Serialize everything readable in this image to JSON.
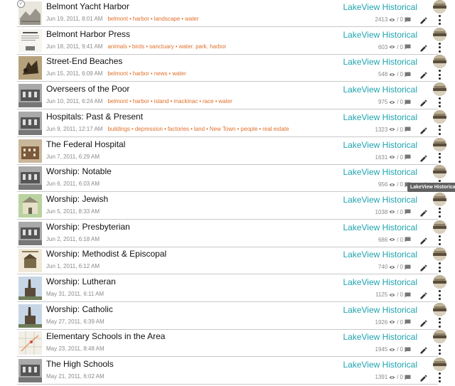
{
  "author_label": "LakeView Historical",
  "tooltip": "LakeView Historical",
  "items": [
    {
      "title": "Belmont Yacht Harbor",
      "date": "Jun 19, 2011, 8:01 AM",
      "tags": [
        "belmont",
        "harbor",
        "landscape",
        "water"
      ],
      "views": "2413",
      "comments": "0",
      "thumb": "sketch"
    },
    {
      "title": "Belmont Harbor Press",
      "date": "Jun 18, 2011, 9:41 AM",
      "tags": [
        "animals",
        "birds",
        "sanctuary",
        "water. park. harbor"
      ],
      "views": "603",
      "comments": "0",
      "thumb": "doc"
    },
    {
      "title": "Street-End Beaches",
      "date": "Jun 15, 2011, 6:09 AM",
      "tags": [
        "belmont",
        "harbor",
        "news",
        "water"
      ],
      "views": "548",
      "comments": "0",
      "thumb": "sepia"
    },
    {
      "title": "Overseers of the Poor",
      "date": "Jun 10, 2011, 6:24 AM",
      "tags": [
        "belmont",
        "harbor",
        "island",
        "mackinac",
        "race",
        "water"
      ],
      "views": "975",
      "comments": "0",
      "thumb": "bw"
    },
    {
      "title": "Hospitals: Past & Present",
      "date": "Jun 9, 2011, 12:17 AM",
      "tags": [
        "buildings",
        "depression",
        "factories",
        "land",
        "New Town",
        "people",
        "real estate"
      ],
      "views": "1323",
      "comments": "0",
      "thumb": "bw"
    },
    {
      "title": "The Federal Hospital",
      "date": "Jun 7, 2011, 6:29 AM",
      "tags": [],
      "views": "1631",
      "comments": "0",
      "thumb": "brown"
    },
    {
      "title": "Worship: Notable",
      "date": "Jun 6, 2011, 6:03 AM",
      "tags": [],
      "views": "956",
      "comments": "0",
      "thumb": "bw"
    },
    {
      "title": "Worship: Jewish",
      "date": "Jun 5, 2011, 8:33 AM",
      "tags": [],
      "views": "1038",
      "comments": "0",
      "thumb": "green"
    },
    {
      "title": "Worship: Presbyterian",
      "date": "Jun 2, 2011, 6:18 AM",
      "tags": [],
      "views": "686",
      "comments": "0",
      "thumb": "bw"
    },
    {
      "title": "Worship: Methodist & Episcopal",
      "date": "Jun 1, 2011, 6:12 AM",
      "tags": [],
      "views": "740",
      "comments": "0",
      "thumb": "card"
    },
    {
      "title": "Worship: Lutheran",
      "date": "May 31, 2011, 6:11 AM",
      "tags": [],
      "views": "1125",
      "comments": "0",
      "thumb": "sky"
    },
    {
      "title": "Worship: Catholic",
      "date": "May 27, 2011, 6:39 AM",
      "tags": [],
      "views": "1926",
      "comments": "0",
      "thumb": "sky"
    },
    {
      "title": "Elementary Schools in the Area",
      "date": "May 23, 2011, 8:48 AM",
      "tags": [],
      "views": "1945",
      "comments": "0",
      "thumb": "map"
    },
    {
      "title": "The High Schools",
      "date": "May 21, 2011, 6:02 AM",
      "tags": [],
      "views": "1391",
      "comments": "0",
      "thumb": "bw"
    }
  ]
}
